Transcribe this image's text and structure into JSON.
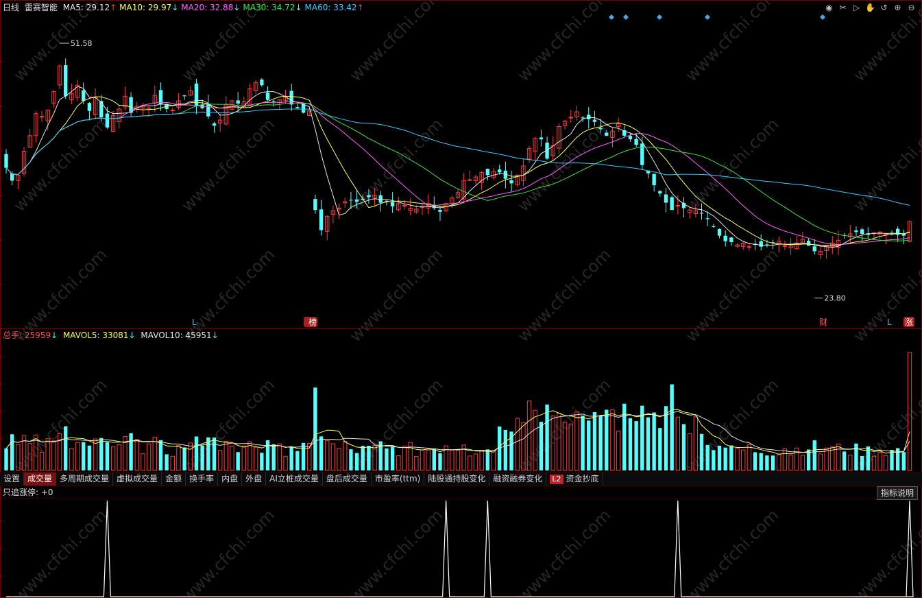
{
  "header": {
    "period": "日线",
    "stock_name": "雷赛智能",
    "ma": [
      {
        "label": "MA5: 29.12",
        "arrow": "↑",
        "color": "#e8e8e8",
        "arrow_color": "#ff4040"
      },
      {
        "label": "MA10: 29.97",
        "arrow": "↓",
        "color": "#ffff50",
        "arrow_color": "#40ffff"
      },
      {
        "label": "MA20: 32.88",
        "arrow": "↓",
        "color": "#ff60ff",
        "arrow_color": "#40ffff"
      },
      {
        "label": "MA30: 34.72",
        "arrow": "↓",
        "color": "#40e040",
        "arrow_color": "#40ffff"
      },
      {
        "label": "MA60: 33.42",
        "arrow": "↑",
        "color": "#40c8ff",
        "arrow_color": "#ff4040"
      }
    ]
  },
  "toolbar_icons": [
    "eye-icon",
    "scissors-icon",
    "play-icon",
    "hand-icon",
    "undo-icon",
    "zoom-in-icon",
    "zoom-out-icon"
  ],
  "vol_header": {
    "total_label": "总手: 25959",
    "total_arrow": "↓",
    "mavol5_label": "MAVOL5: 33081",
    "mavol5_arrow": "↓",
    "mavol10_label": "MAVOL10: 45951",
    "mavol10_arrow": "↓"
  },
  "tabs": [
    {
      "label": "设置"
    },
    {
      "label": "成交量",
      "active": true
    },
    {
      "label": "多周期成交量"
    },
    {
      "label": "虚拟成交量"
    },
    {
      "label": "金额"
    },
    {
      "label": "换手率"
    },
    {
      "label": "内盘"
    },
    {
      "label": "外盘"
    },
    {
      "label": "AI立桩成交量"
    },
    {
      "label": "盘后成交量"
    },
    {
      "label": "市盈率(ttm)"
    },
    {
      "label": "陆股通持股变化"
    },
    {
      "label": "融资融券变化"
    },
    {
      "label": "资金抄底",
      "badge": "L2"
    }
  ],
  "indicator": {
    "title": "只追涨停: +0",
    "explain_label": "指标说明"
  },
  "markers": {
    "high_label": "51.58",
    "low_label": "23.80",
    "l_left": "L",
    "rank": "榜",
    "cai": "财",
    "l_right": "L",
    "zhang": "涨"
  },
  "watermark": "www.cfchi.com",
  "chart_data": [
    {
      "type": "candlestick",
      "title": "雷赛智能",
      "period": "日线",
      "price_range": [
        22.5,
        53
      ],
      "high": 51.58,
      "low": 23.8,
      "close": [
        38.0,
        36.6,
        37.2,
        39.8,
        41.5,
        43.9,
        43.6,
        44.3,
        46.3,
        49.1,
        45.8,
        46.1,
        47.0,
        45.3,
        44.2,
        45.7,
        43.5,
        42.4,
        43.7,
        44.4,
        45.8,
        44.0,
        44.7,
        44.8,
        44.5,
        45.9,
        44.9,
        44.4,
        44.3,
        45.3,
        45.8,
        46.4,
        44.8,
        44.5,
        43.6,
        42.6,
        43.2,
        44.9,
        45.3,
        45.0,
        45.2,
        46.6,
        47.3,
        47.0,
        45.4,
        45.2,
        45.4,
        45.7,
        44.9,
        44.5,
        44.0,
        44.2,
        33.4,
        31.2,
        32.7,
        33.3,
        33.6,
        34.3,
        34.5,
        34.3,
        34.5,
        34.8,
        35.0,
        34.2,
        34.3,
        33.8,
        34.1,
        33.9,
        33.6,
        33.5,
        33.8,
        34.1,
        33.6,
        33.2,
        34.1,
        34.7,
        35.3,
        36.6,
        36.7,
        37.0,
        37.5,
        37.2,
        37.6,
        37.5,
        36.8,
        36.3,
        37.2,
        38.2,
        40.1,
        41.2,
        41.1,
        39.0,
        40.4,
        42.5,
        43.1,
        43.5,
        44.1,
        43.4,
        43.3,
        43.0,
        42.2,
        41.5,
        42.0,
        42.8,
        41.5,
        41.1,
        40.5,
        38.3,
        37.4,
        36.1,
        35.2,
        34.2,
        33.4,
        33.9,
        33.6,
        33.4,
        33.3,
        33.0,
        32.4,
        31.6,
        30.6,
        30.0,
        29.9,
        29.6,
        29.8,
        29.4,
        29.6,
        29.4,
        29.6,
        29.8,
        30.0,
        29.5,
        29.5,
        29.8,
        30.2,
        29.5,
        28.9,
        28.9,
        29.5,
        29.8,
        30.1,
        30.6,
        30.8,
        31.0,
        30.8,
        30.7,
        30.9,
        31.0,
        30.8,
        30.9,
        30.7,
        30.6,
        32.1
      ]
    },
    {
      "type": "bar",
      "title": "成交量",
      "series": [
        {
          "name": "总手",
          "value": 25959
        },
        {
          "name": "MAVOL5",
          "value": 33081
        },
        {
          "name": "MAVOL10",
          "value": 45951
        }
      ]
    }
  ]
}
